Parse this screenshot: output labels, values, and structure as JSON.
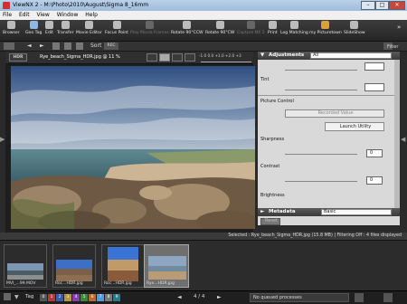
{
  "window": {
    "title": "ViewNX 2 - M:\\Photo\\2010\\August\\Sigma 8_16mm",
    "min": "–",
    "max": "□",
    "close": "✕"
  },
  "menu": [
    "File",
    "Edit",
    "View",
    "Window",
    "Help"
  ],
  "toolbar": {
    "items": [
      {
        "label": "Browser",
        "icon": "browser-icon"
      },
      {
        "label": "Geo Tag",
        "icon": "globe-icon"
      },
      {
        "label": "Edit",
        "icon": "edit-icon"
      },
      {
        "label": "Transfer",
        "icon": "transfer-icon"
      },
      {
        "label": "Movie Editor",
        "icon": "movie-icon"
      },
      {
        "label": "Focus Point",
        "icon": "focus-icon"
      },
      {
        "label": "Play Movie Frames",
        "icon": "play-icon"
      },
      {
        "label": "Rotate 90°CCW",
        "icon": "rotate-ccw-icon"
      },
      {
        "label": "Rotate 90°CW",
        "icon": "rotate-cw-icon"
      },
      {
        "label": "Capture NX 2",
        "icon": "capture-icon"
      },
      {
        "label": "Print",
        "icon": "print-icon"
      },
      {
        "label": "Log Matching",
        "icon": "log-icon"
      },
      {
        "label": "my Picturetown",
        "icon": "picturetown-icon"
      },
      {
        "label": "SlideShow",
        "icon": "slideshow-icon"
      }
    ],
    "more": "»"
  },
  "navbar": {
    "sort_label": "Sort",
    "sort_value": "REC",
    "filter_label": "Filter"
  },
  "viewer": {
    "file_badge": "HDR",
    "file_title": "Rye_beach_Sigma_HDR.jpg @ 11 %",
    "exposure_scale": "-1.0  0.0  +1.0  +2.0  +3"
  },
  "adjustments": {
    "header": "Adjustments",
    "preset": "All",
    "tint_label": "Tint",
    "picture_control_label": "Picture Control",
    "picture_control_value": "Recorded Value",
    "launch_button": "Launch Utility",
    "sharpness_label": "Sharpness",
    "sharpness_value": "0",
    "contrast_label": "Contrast",
    "contrast_value": "0",
    "brightness_label": "Brightness",
    "reset_button": "Reset"
  },
  "metadata": {
    "header": "Metadata",
    "preset": "Basic"
  },
  "status": {
    "text": "Selected : Rye_beach_Sigma_HDR.jpg (15.8 MB) | Filtering Off : 4 files displayed"
  },
  "filmstrip": {
    "thumbnails": [
      {
        "caption": "MVI_...99.MOV",
        "colors": [
          "#7d96b4",
          "#4c5b66",
          "#8b8f8f"
        ],
        "selected": false
      },
      {
        "caption": "Roc...HDR.jpg",
        "colors": [
          "#3d6fc9",
          "#7a6048",
          "#8c6f52"
        ],
        "selected": false
      },
      {
        "caption": "Roc...HDR.jpg",
        "colors": [
          "#3a73d4",
          "#c19a6a",
          "#8a5b3a"
        ],
        "selected": false
      },
      {
        "caption": "Rye...HDR.jpg",
        "colors": [
          "#8ea6c2",
          "#6f8b9d",
          "#b99b77"
        ],
        "selected": true
      }
    ]
  },
  "bottombar": {
    "tag_label": "Tag",
    "tags": [
      "0",
      "1",
      "2",
      "3",
      "4",
      "5",
      "6",
      "7",
      "8",
      "9"
    ],
    "tag_colors": [
      "#555555",
      "#b33a3a",
      "#3a5ab3",
      "#b39a3a",
      "#8a3ab3",
      "#3a8a3a",
      "#c06a2a",
      "#5a9ad9",
      "#7a7a7a",
      "#2a7a8a"
    ],
    "page": "4 / 4",
    "queue": "No queued processes"
  }
}
